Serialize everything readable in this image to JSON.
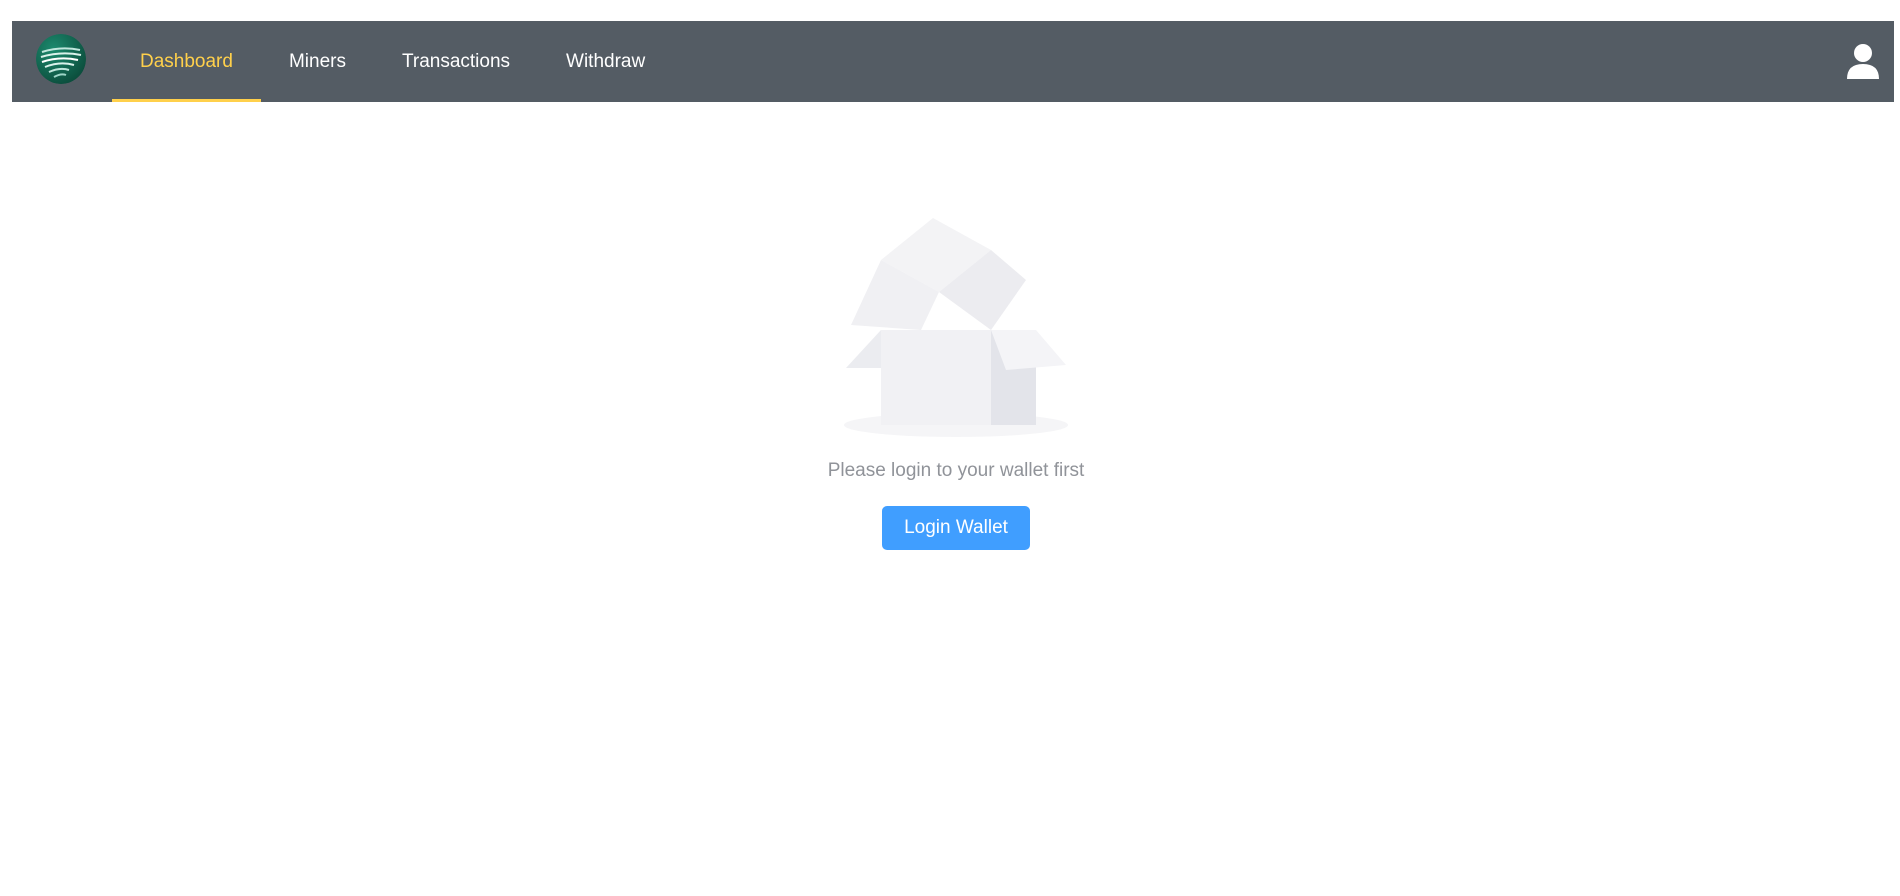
{
  "nav": {
    "logo_icon": "globe-logo-icon",
    "items": [
      {
        "label": "Dashboard",
        "active": true
      },
      {
        "label": "Miners",
        "active": false
      },
      {
        "label": "Transactions",
        "active": false
      },
      {
        "label": "Withdraw",
        "active": false
      }
    ],
    "user_icon": "user-icon"
  },
  "main": {
    "illustration_icon": "empty-box-icon",
    "message": "Please login to your wallet first",
    "login_button_label": "Login Wallet"
  },
  "colors": {
    "navbar_bg": "#545c64",
    "active_nav": "#ffd04b",
    "primary_button": "#409eff",
    "message_text": "#909399"
  }
}
